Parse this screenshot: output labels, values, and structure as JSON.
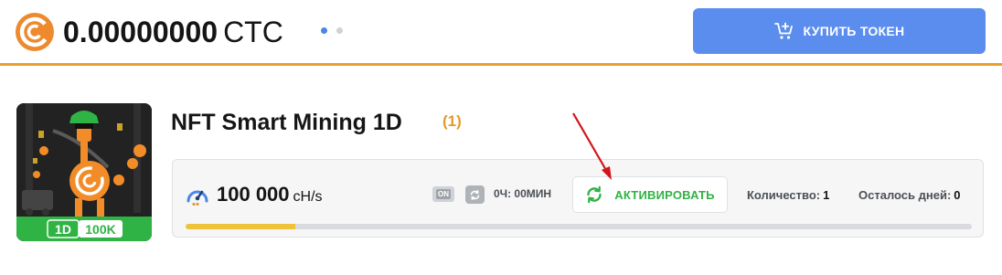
{
  "header": {
    "balance_amount": "0.00000000",
    "balance_unit": "CTC",
    "buy_button_label": "КУПИТЬ ТОКЕН",
    "accent_color": "#e9a02a",
    "button_color": "#5b8def"
  },
  "nft": {
    "title": "NFT Smart Mining 1D",
    "count": "(1)",
    "image_badge_duration": "1D",
    "image_badge_power": "100K"
  },
  "panel": {
    "hashrate_value": "100 000",
    "hashrate_unit": "cH/s",
    "on_badge": "ON",
    "time_left": "0Ч: 00МИН",
    "activate_label": "АКТИВИРОВАТЬ",
    "quantity_label": "Количество:",
    "quantity_value": "1",
    "days_left_label": "Осталось дней:",
    "days_left_value": "0",
    "progress_fraction": 0.14,
    "progress_color": "#f0c23c"
  }
}
